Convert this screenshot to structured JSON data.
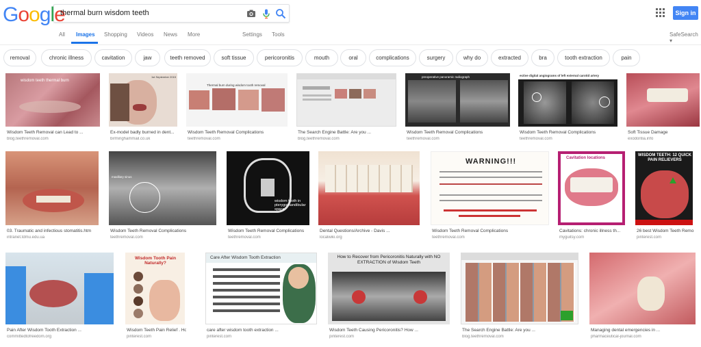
{
  "header": {
    "logo_letters": [
      {
        "ch": "G",
        "color": "#4285f4"
      },
      {
        "ch": "o",
        "color": "#ea4335"
      },
      {
        "ch": "o",
        "color": "#fbbc05"
      },
      {
        "ch": "g",
        "color": "#4285f4"
      },
      {
        "ch": "l",
        "color": "#34a853"
      },
      {
        "ch": "e",
        "color": "#ea4335"
      }
    ],
    "query": "thermal burn wisdom teeth",
    "signin_label": "Sign in",
    "accent": "#4285f4"
  },
  "tabs": [
    "All",
    "Images",
    "Shopping",
    "Videos",
    "News",
    "More"
  ],
  "active_tab": "Images",
  "tools": [
    "Settings",
    "Tools"
  ],
  "safesearch": "SafeSearch ▾",
  "chips": [
    "removal",
    "chronic illness",
    "cavitation",
    "jaw",
    "teeth removed",
    "soft tissue",
    "pericoronitis",
    "mouth",
    "oral",
    "complications",
    "surgery",
    "why do",
    "extracted",
    "bra",
    "tooth extraction",
    "pain"
  ],
  "results": [
    {
      "caption": "Wisdom Teeth Removal can Lead to ...",
      "source": "blog.teethremoval.com",
      "overlay": "wisdom teeth thermal burn"
    },
    {
      "caption": "Ex-model badly burned in dent...",
      "source": "birminghammail.co.uk",
      "overlay": "1st September 2015"
    },
    {
      "caption": "Wisdom Teeth Removal Complications",
      "source": "teethremoval.com",
      "overlay": "Thermal burn during wisdom tooth removal"
    },
    {
      "caption": "The Search Engine Battle: Are you ...",
      "source": "blog.teethremoval.com",
      "overlay": ""
    },
    {
      "caption": "Wisdom Teeth Removal Complications",
      "source": "teethremoval.com",
      "overlay": "preoperative panoramic radiograph"
    },
    {
      "caption": "Wisdom Teeth Removal Complications",
      "source": "teethremoval.com",
      "overlay": "ective digital angiograms of left external carotid artery"
    },
    {
      "caption": "Soft Tissue Damage",
      "source": "exodontia.info",
      "overlay": ""
    },
    {
      "caption": "03. Traumatic and infectious stomatitis.htm",
      "source": "intranet.tdmu.edu.ua",
      "overlay": ""
    },
    {
      "caption": "Wisdom Teeth Removal Complications",
      "source": "teethremoval.com",
      "overlay": "maxillary sinus"
    },
    {
      "caption": "Wisdom Teeth Removal Complications",
      "source": "teethremoval.com",
      "overlay": "wisdom tooth in pterygomandibular space"
    },
    {
      "caption": "Dental Questions/Archive - Davis ...",
      "source": "localwiki.org",
      "overlay": ""
    },
    {
      "caption": "Wisdom Teeth Removal Complications",
      "source": "teethremoval.com",
      "overlay": "WARNING!!!"
    },
    {
      "caption": "Cavitations: chronic illness th...",
      "source": "myguitsy.com",
      "overlay": "Cavitation locations"
    },
    {
      "caption": "26 best Wisdom Teeth Remo...",
      "source": "pinterest.com",
      "overlay": "WISDOM TEETH: 12 QUICK PAIN RELIEVERS"
    },
    {
      "caption": "Pain After Wisdom Tooth Extraction ...",
      "source": "committedtofreedom.org",
      "overlay": ""
    },
    {
      "caption": "Wisdom Teeth Pain Relief . Ho...",
      "source": "pinterest.com",
      "overlay": "Wisdom Tooth Pain Naturally?"
    },
    {
      "caption": "care after wisdom tooth extraction ...",
      "source": "pinterest.com",
      "overlay": "Care After Wisdom Tooth Extraction"
    },
    {
      "caption": "Wisdom Teeth Causing Pericoronitis? How ...",
      "source": "pinterest.com",
      "overlay": "How to Recover from Pericoronitis Naturally with NO EXTRACTION of Wisdom Teeth"
    },
    {
      "caption": "The Search Engine Battle: Are you ...",
      "source": "blog.teethremoval.com",
      "overlay": ""
    },
    {
      "caption": "Managing dental emergencies in ...",
      "source": "pharmaceutical-journal.com",
      "overlay": ""
    }
  ]
}
